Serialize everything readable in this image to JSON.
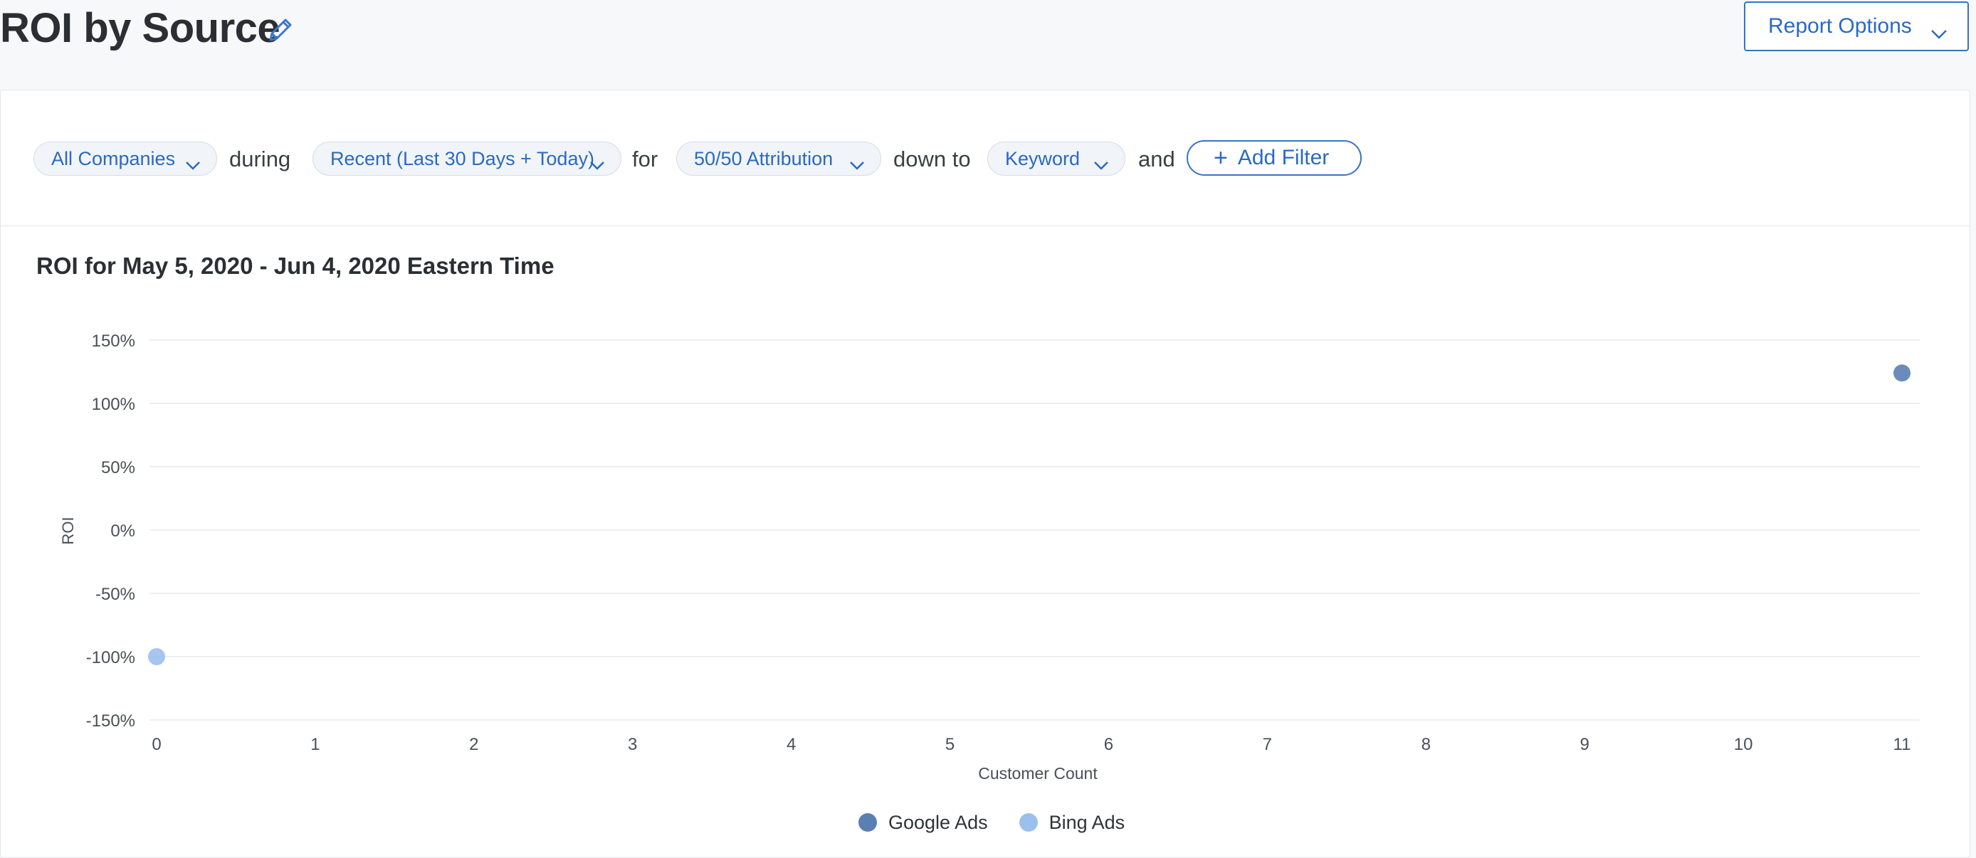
{
  "header": {
    "title": "ROI by Source",
    "report_options_label": "Report Options"
  },
  "filters": {
    "company": "All Companies",
    "during_label": "during",
    "date_range": "Recent (Last 30 Days + Today)",
    "for_label": "for",
    "attribution": "50/50 Attribution",
    "down_to_label": "down to",
    "granularity": "Keyword",
    "and_label": "and",
    "add_filter_label": "Add Filter"
  },
  "colors": {
    "accent": "#2a6ac1",
    "google": "#5a7fb3",
    "bing": "#9cc0ee"
  },
  "chart_data": {
    "type": "scatter",
    "title": "ROI for May 5, 2020 - Jun 4, 2020 Eastern Time",
    "xlabel": "Customer Count",
    "ylabel": "ROI",
    "xlim": [
      0,
      11
    ],
    "ylim": [
      -150,
      150
    ],
    "x_ticks": [
      "0",
      "1",
      "2",
      "3",
      "4",
      "5",
      "6",
      "7",
      "8",
      "9",
      "10",
      "11"
    ],
    "y_ticks": [
      "150%",
      "100%",
      "50%",
      "0%",
      "-50%",
      "-100%",
      "-150%"
    ],
    "y_tick_values": [
      150,
      100,
      50,
      0,
      -50,
      -100,
      -150
    ],
    "grid": true,
    "legend_position": "bottom",
    "series": [
      {
        "name": "Google Ads",
        "color": "#5a7fb3",
        "points": [
          {
            "x": 11,
            "y": 124
          }
        ]
      },
      {
        "name": "Bing Ads",
        "color": "#9cc0ee",
        "points": [
          {
            "x": 0,
            "y": -100
          }
        ]
      }
    ]
  }
}
